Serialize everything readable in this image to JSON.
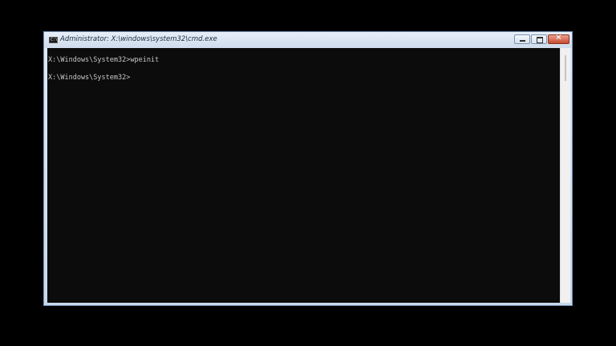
{
  "window": {
    "title": "Administrator: X:\\windows\\system32\\cmd.exe",
    "icon_label": "C:\\",
    "icon": "cmd-icon"
  },
  "caption_buttons": {
    "minimize_icon": "minimize-icon",
    "maximize_icon": "maximize-icon",
    "close_icon": "close-icon",
    "close_glyph": "✕"
  },
  "console": {
    "lines": [
      "X:\\Windows\\System32>wpeinit",
      "X:\\Windows\\System32>"
    ],
    "background": "#0c0c0c",
    "foreground": "#c8c8c8"
  },
  "colors": {
    "desktop": "#000000",
    "close_button": "#c8492f"
  }
}
